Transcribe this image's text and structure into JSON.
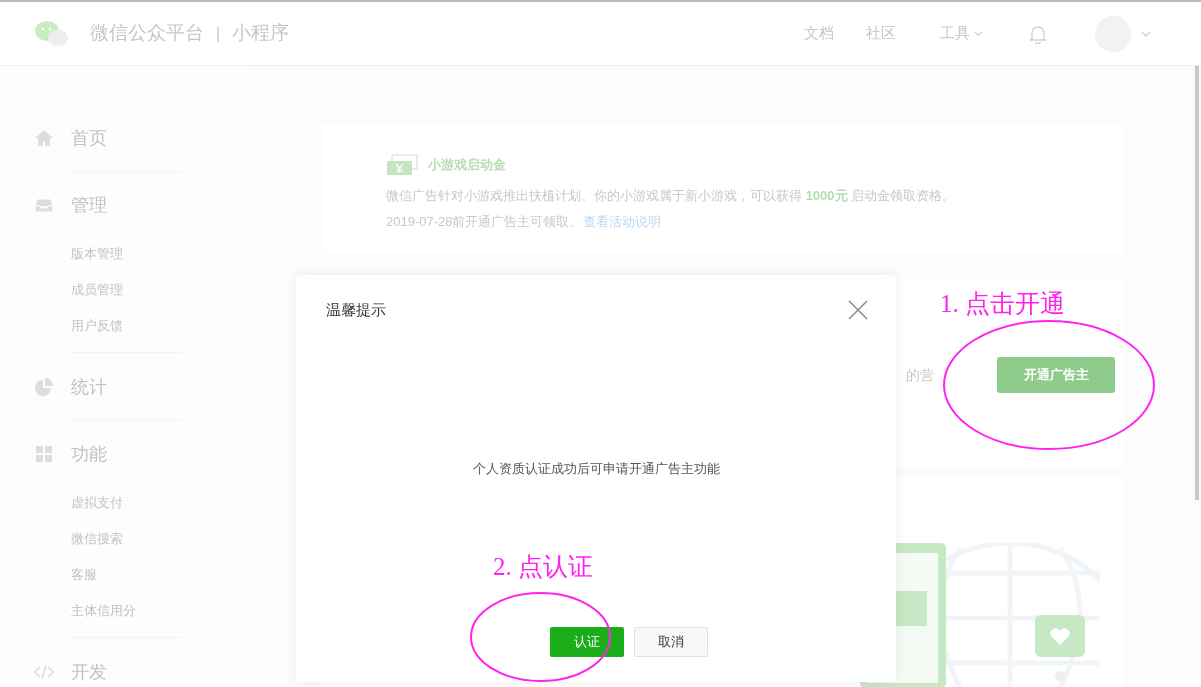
{
  "header": {
    "brand": "微信公众平台",
    "separator": "|",
    "product": "小程序",
    "nav": [
      {
        "label": "文档",
        "kind": "link"
      },
      {
        "label": "社区",
        "kind": "link"
      },
      {
        "label": "工具",
        "kind": "dropdown"
      }
    ]
  },
  "sidebar": {
    "sections": [
      {
        "kind": "home",
        "label": "首页"
      },
      {
        "kind": "inbox",
        "label": "管理",
        "children": [
          {
            "label": "版本管理"
          },
          {
            "label": "成员管理"
          },
          {
            "label": "用户反馈"
          }
        ]
      },
      {
        "kind": "pie",
        "label": "统计"
      },
      {
        "kind": "grid",
        "label": "功能",
        "children": [
          {
            "label": "虚拟支付"
          },
          {
            "label": "微信搜索"
          },
          {
            "label": "客服"
          },
          {
            "label": "主体信用分"
          }
        ]
      },
      {
        "kind": "code",
        "label": "开发"
      }
    ]
  },
  "promo": {
    "title": "小游戏启动金",
    "text": "微信广告针对小游戏推出扶植计划。你的小游戏属于新小游戏，可以获得 **1000元** 启动金领取资格。",
    "line2": "2019-07-28前开通广告主可领取。",
    "link": "查看活动说明"
  },
  "advertiser": {
    "text_fragment": "的营",
    "button": "开通广告主"
  },
  "dialog": {
    "title": "温馨提示",
    "message": "个人资质认证成功后可申请开通广告主功能",
    "buttons": [
      {
        "label": "认证",
        "kind": "primary"
      },
      {
        "label": "取消",
        "kind": "default"
      }
    ]
  },
  "annotations": [
    {
      "text": "1. 点击开通"
    },
    {
      "text": "2. 点认证"
    }
  ]
}
